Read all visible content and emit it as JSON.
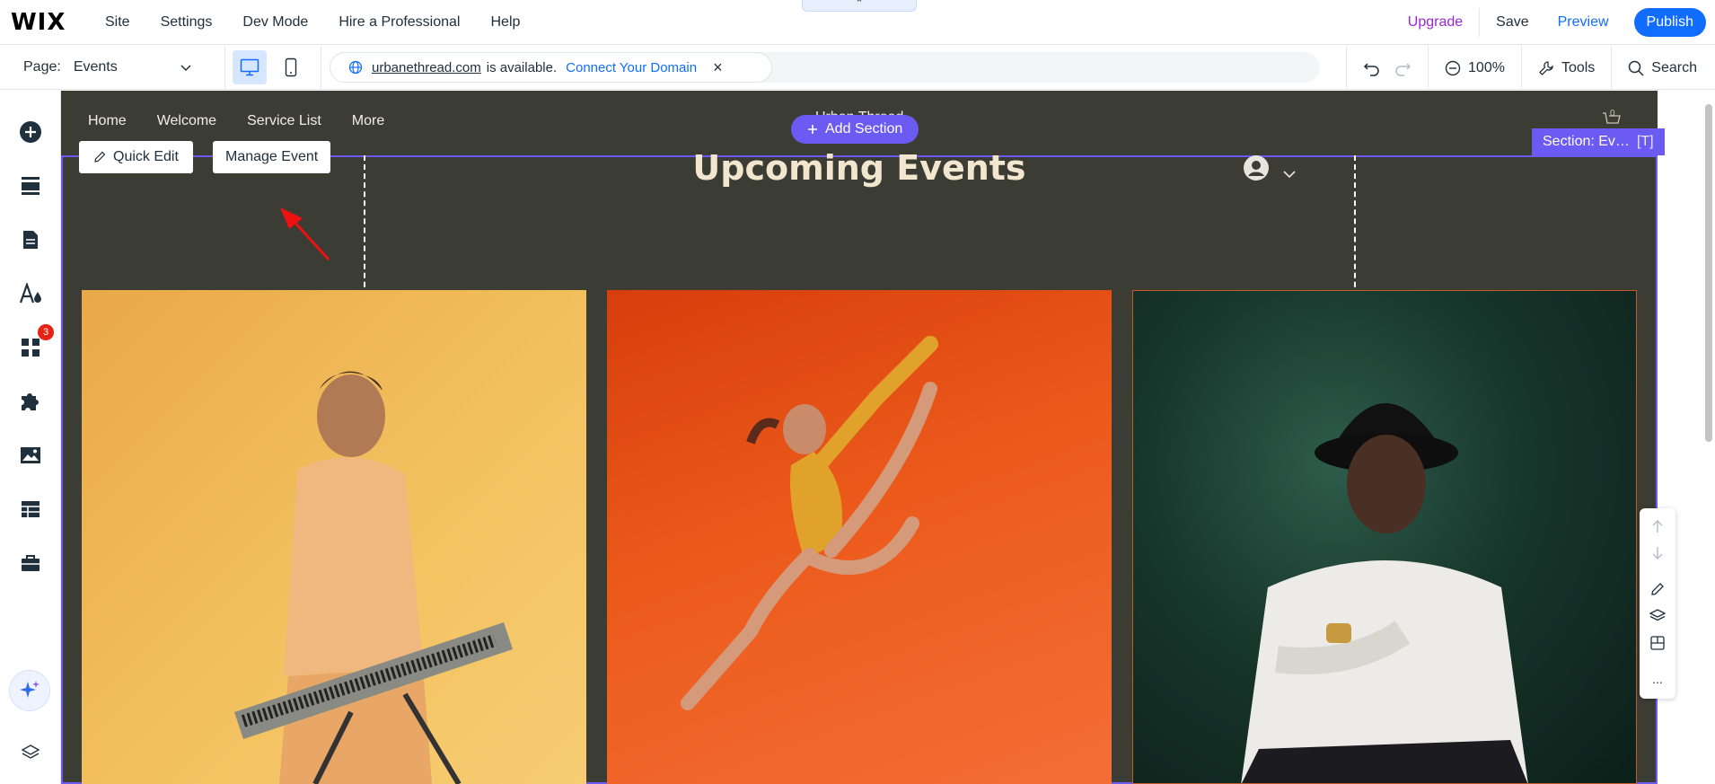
{
  "topbar": {
    "logo": "WIX",
    "menu": [
      "Site",
      "Settings",
      "Dev Mode",
      "Hire a Professional",
      "Help"
    ],
    "upgrade": "Upgrade",
    "save": "Save",
    "preview": "Preview",
    "publish": "Publish",
    "collapse_glyph": "⌃"
  },
  "secondbar": {
    "page_label": "Page:",
    "page_value": "Events",
    "domain": "urbanethread.com",
    "available": "is available.",
    "connect": "Connect Your Domain",
    "close": "×",
    "zoom": "100%",
    "tools": "Tools",
    "search": "Search"
  },
  "lefttools": {
    "badge_count": "3"
  },
  "site": {
    "nav": [
      "Home",
      "Welcome",
      "Service List",
      "More"
    ],
    "brand": "Urban Thread",
    "cart_count": "0"
  },
  "section": {
    "label": "Section: Ev…",
    "label_tag": "[T]",
    "add_section": "Add Section",
    "quick_edit": "Quick Edit",
    "manage_event": "Manage Event",
    "title": "Upcoming Events"
  },
  "floatbar": {
    "more": "..."
  },
  "colors": {
    "accent": "#116dff",
    "section_purple": "#6b5bf2",
    "site_bg": "#3b3c33",
    "title": "#f3e6cf",
    "upgrade": "#9a27d5"
  }
}
